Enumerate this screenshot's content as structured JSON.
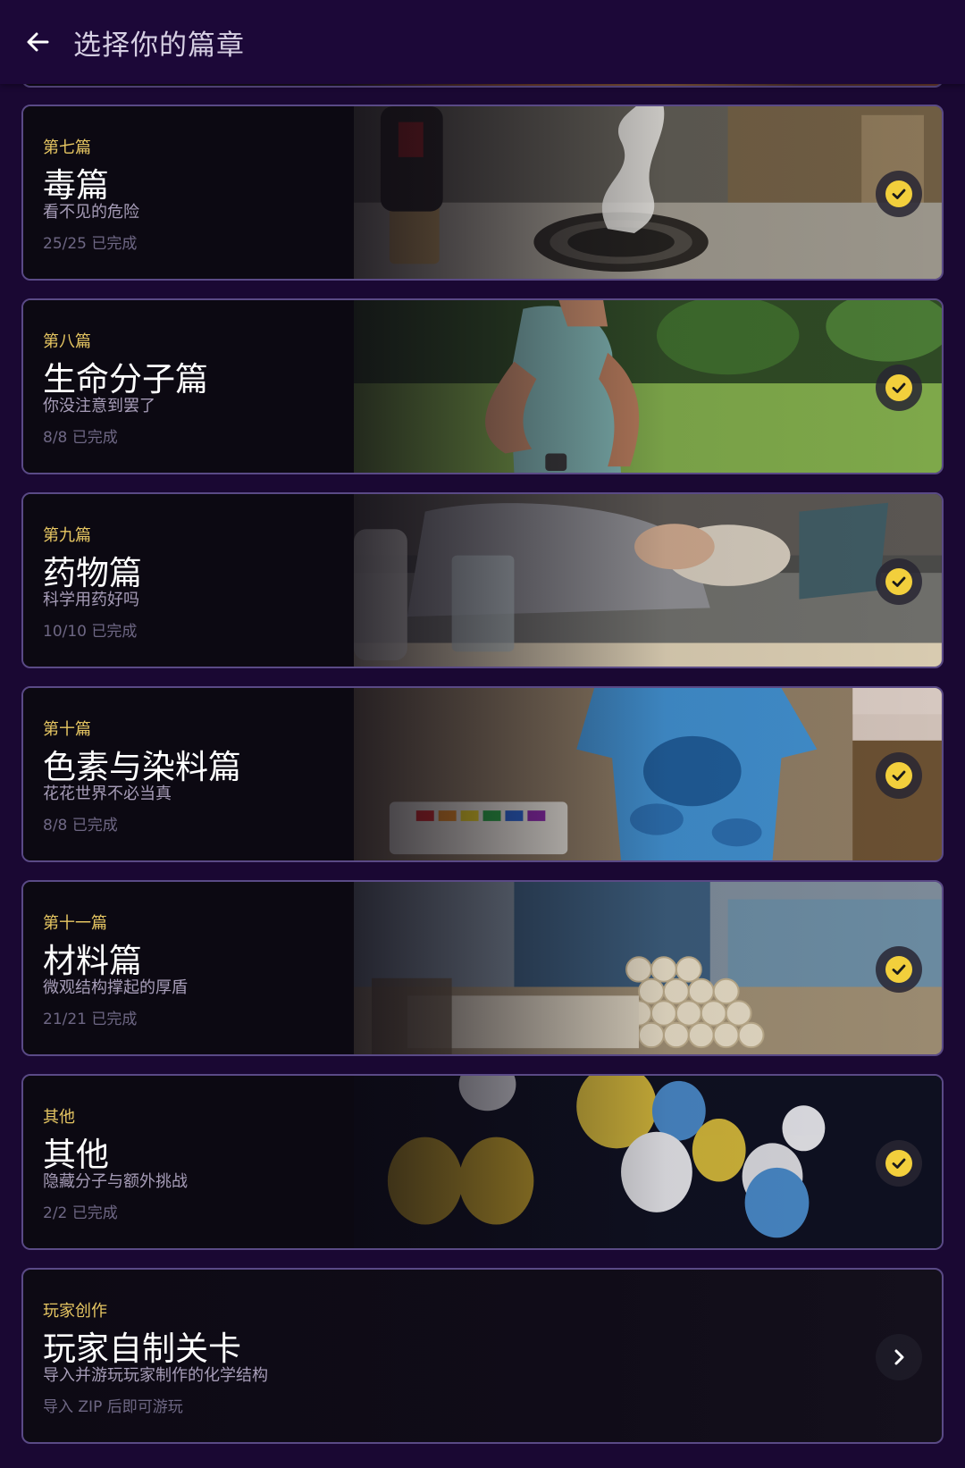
{
  "header": {
    "title": "选择你的篇章",
    "back_icon": "arrow-left-icon"
  },
  "colors": {
    "background": "#1a0833",
    "card_border": "#5a4a86",
    "chapter_label": "#e6c662",
    "check": "#f2cf3c"
  },
  "chapters": [
    {
      "chapter": "第七篇",
      "title": "毒篇",
      "subtitle": "看不见的危险",
      "progress": "25/25 已完成",
      "completed": true,
      "icon": "check-icon"
    },
    {
      "chapter": "第八篇",
      "title": "生命分子篇",
      "subtitle": "你没注意到罢了",
      "progress": "8/8 已完成",
      "completed": true,
      "icon": "check-icon"
    },
    {
      "chapter": "第九篇",
      "title": "药物篇",
      "subtitle": "科学用药好吗",
      "progress": "10/10 已完成",
      "completed": true,
      "icon": "check-icon"
    },
    {
      "chapter": "第十篇",
      "title": "色素与染料篇",
      "subtitle": "花花世界不必当真",
      "progress": "8/8 已完成",
      "completed": true,
      "icon": "check-icon"
    },
    {
      "chapter": "第十一篇",
      "title": "材料篇",
      "subtitle": "微观结构撑起的厚盾",
      "progress": "21/21 已完成",
      "completed": true,
      "icon": "check-icon"
    },
    {
      "chapter": "其他",
      "title": "其他",
      "subtitle": "隐藏分子与额外挑战",
      "progress": "2/2 已完成",
      "completed": true,
      "icon": "check-icon"
    },
    {
      "chapter": "玩家创作",
      "title": "玩家自制关卡",
      "subtitle": "导入并游玩玩家制作的化学结构",
      "progress": "导入 ZIP 后即可游玩",
      "completed": false,
      "icon": "chevron-right-icon"
    }
  ]
}
